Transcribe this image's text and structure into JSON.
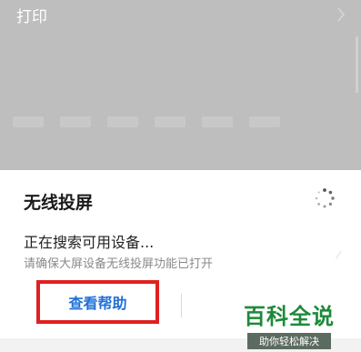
{
  "background": {
    "print_item": {
      "label": "打印"
    }
  },
  "dialog": {
    "title": "无线投屏",
    "status": "正在搜索可用设备...",
    "hint": "请确保大屏设备无线投屏功能已打开",
    "help_button": "查看帮助"
  },
  "watermark": {
    "main": "百科全说",
    "sub": "助你轻松解决"
  },
  "colors": {
    "highlight_border": "#e02020",
    "link_blue": "#1f6fd6",
    "logo_green": "#1d8a3a"
  },
  "icons": {
    "chevron": "chevron-right-icon",
    "spinner": "loading-spinner-icon"
  }
}
